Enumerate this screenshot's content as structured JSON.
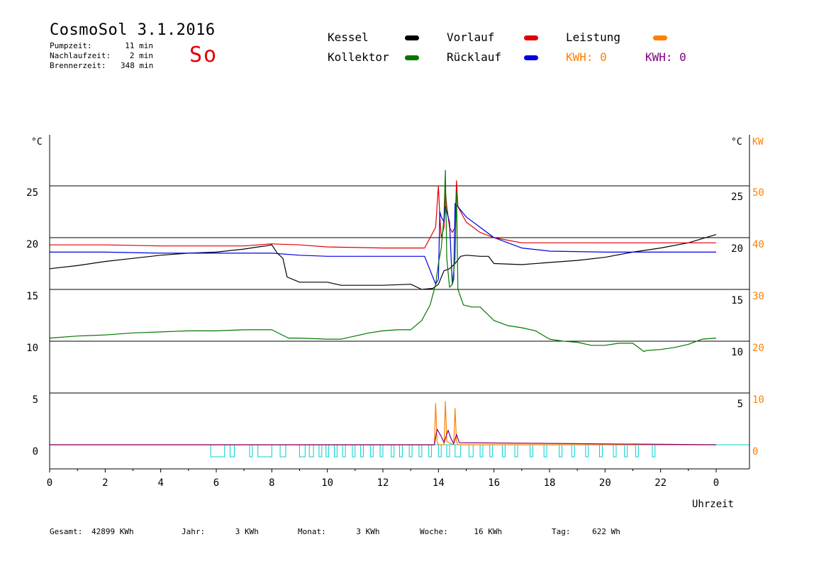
{
  "header": {
    "title": "CosmoSol 3.1.2016",
    "pump_label": "Pumpzeit:",
    "pump_value": "11 min",
    "after_label": "Nachlaufzeit:",
    "after_value": "2 min",
    "burner_label": "Brennerzeit:",
    "burner_value": "348 min",
    "weekday": "So"
  },
  "legend": {
    "kessel": "Kessel",
    "kollektor": "Kollektor",
    "vorlauf": "Vorlauf",
    "ruecklauf": "Rücklauf",
    "leistung": "Leistung",
    "kwh_orange": "KWH: 0",
    "kwh_purple": "KWH: 0",
    "colors": {
      "kessel": "#000000",
      "kollektor": "#007800",
      "vorlauf": "#e00000",
      "ruecklauf": "#0000e0",
      "leistung": "#ff8000",
      "purple": "#800080",
      "pump": "#00d0d0"
    }
  },
  "footer": {
    "gesamt_label": "Gesamt:",
    "gesamt_value": "42899 KWh",
    "jahr_label": "Jahr:",
    "jahr_value": "3 KWh",
    "monat_label": "Monat:",
    "monat_value": "3 KWh",
    "woche_label": "Woche:",
    "woche_value": "16 KWh",
    "tag_label": "Tag:",
    "tag_value": "622 Wh"
  },
  "chart_data": {
    "type": "line",
    "xlabel": "Uhrzeit",
    "left_unit": "°C",
    "right_unit_temp": "°C",
    "right_unit_power": "KW",
    "xlim": [
      0,
      24
    ],
    "ylim": [
      -2.3,
      30
    ],
    "x_ticks": [
      "0",
      "2",
      "4",
      "6",
      "8",
      "10",
      "12",
      "14",
      "16",
      "18",
      "20",
      "22",
      "0"
    ],
    "left_ticks": [
      0,
      5,
      10,
      15,
      20,
      25
    ],
    "right_temp_ticks": [
      5,
      10,
      15,
      20,
      25
    ],
    "right_power_ticks": [
      0,
      10,
      20,
      30,
      40,
      50
    ],
    "gridlines": [
      0,
      5,
      10,
      15,
      20,
      25
    ],
    "series": [
      {
        "name": "Kessel",
        "color": "#000000",
        "x": [
          0,
          1,
          2,
          3,
          4,
          5,
          6,
          7,
          7.5,
          7.8,
          8.0,
          8.2,
          8.4,
          8.55,
          9,
          10,
          10.5,
          11,
          12,
          13,
          13.4,
          13.8,
          14.0,
          14.2,
          14.4,
          14.6,
          14.8,
          15.0,
          15.5,
          15.8,
          16,
          17,
          18,
          19,
          20,
          21,
          22,
          23,
          24
        ],
        "y": [
          17.0,
          17.3,
          17.7,
          18.0,
          18.3,
          18.5,
          18.6,
          18.9,
          19.1,
          19.2,
          19.3,
          18.5,
          18.0,
          16.2,
          15.7,
          15.7,
          15.4,
          15.4,
          15.4,
          15.5,
          15.0,
          15.1,
          15.5,
          16.8,
          17.0,
          17.5,
          18.2,
          18.3,
          18.2,
          18.2,
          17.5,
          17.4,
          17.6,
          17.8,
          18.1,
          18.6,
          19.0,
          19.5,
          20.3
        ]
      },
      {
        "name": "Vorlauf",
        "color": "#e00000",
        "x": [
          0,
          2,
          4,
          6,
          7,
          8,
          9,
          10,
          12,
          13.5,
          13.9,
          14.0,
          14.05,
          14.1,
          14.2,
          14.25,
          14.3,
          14.4,
          14.5,
          14.6,
          14.65,
          14.7,
          15,
          15.5,
          16,
          17,
          18,
          20,
          22,
          24
        ],
        "y": [
          19.3,
          19.3,
          19.2,
          19.2,
          19.2,
          19.4,
          19.3,
          19.1,
          19.0,
          19.0,
          21.0,
          25.0,
          22.0,
          20.0,
          21.0,
          24.5,
          23.0,
          21.0,
          20.5,
          21.0,
          25.5,
          23.0,
          21.5,
          20.5,
          20.0,
          19.5,
          19.5,
          19.5,
          19.5,
          19.5
        ]
      },
      {
        "name": "Rücklauf",
        "color": "#0000e0",
        "x": [
          0,
          2,
          4,
          6,
          8,
          9,
          10,
          12,
          13.5,
          13.9,
          14.0,
          14.05,
          14.1,
          14.2,
          14.25,
          14.3,
          14.4,
          14.5,
          14.55,
          14.6,
          14.7,
          15,
          15.5,
          16,
          16.5,
          17,
          18,
          20,
          22,
          24
        ],
        "y": [
          18.6,
          18.6,
          18.5,
          18.5,
          18.5,
          18.3,
          18.2,
          18.2,
          18.2,
          15.5,
          16.0,
          22.5,
          22.0,
          21.5,
          23.0,
          22.5,
          21.5,
          15.5,
          16.0,
          23.3,
          23.0,
          22.0,
          21.0,
          20.0,
          19.5,
          19.0,
          18.7,
          18.6,
          18.6,
          18.6
        ]
      },
      {
        "name": "Kollektor",
        "color": "#007800",
        "x": [
          0,
          1,
          2,
          3,
          4,
          5,
          6,
          7,
          8,
          8.6,
          9,
          10,
          10.5,
          11,
          11.5,
          12,
          12.5,
          13,
          13.4,
          13.7,
          13.9,
          14.0,
          14.1,
          14.2,
          14.25,
          14.3,
          14.4,
          14.5,
          14.6,
          14.65,
          14.7,
          14.9,
          15.2,
          15.5,
          16,
          16.5,
          17,
          17.5,
          18,
          18.5,
          19,
          19.5,
          20,
          20.5,
          21,
          21.4,
          21.5,
          22,
          22.5,
          23,
          23.5,
          24
        ],
        "y": [
          10.3,
          10.5,
          10.6,
          10.8,
          10.9,
          11.0,
          11.0,
          11.1,
          11.1,
          10.3,
          10.3,
          10.2,
          10.2,
          10.5,
          10.8,
          11.0,
          11.1,
          11.1,
          12.0,
          13.5,
          15.5,
          17.5,
          19.0,
          22.0,
          26.5,
          18.0,
          15.2,
          15.5,
          18.0,
          24.5,
          15.0,
          13.5,
          13.3,
          13.3,
          12.0,
          11.5,
          11.3,
          11.0,
          10.2,
          10.0,
          9.9,
          9.6,
          9.6,
          9.8,
          9.8,
          9.0,
          9.1,
          9.2,
          9.4,
          9.7,
          10.2,
          10.3
        ]
      },
      {
        "name": "Leistung",
        "color": "#ff8000",
        "x": [
          0,
          13.85,
          13.9,
          13.95,
          14.0,
          14.2,
          14.25,
          14.3,
          14.55,
          14.6,
          14.65,
          14.7,
          14.75,
          24
        ],
        "y": [
          0,
          0,
          4.0,
          0.3,
          0,
          0,
          4.2,
          0.3,
          0,
          3.5,
          0.3,
          0,
          0,
          0
        ]
      },
      {
        "name": "Leistung2",
        "color": "#800080",
        "x": [
          0,
          13.85,
          13.95,
          14.1,
          14.2,
          14.35,
          14.45,
          14.55,
          14.65,
          14.75,
          24
        ],
        "y": [
          0,
          0,
          1.5,
          0.8,
          0.2,
          1.4,
          0.6,
          0.1,
          1.0,
          0.2,
          0
        ]
      }
    ],
    "pump_pulses": [
      [
        5.8,
        6.3
      ],
      [
        6.5,
        6.65
      ],
      [
        7.2,
        7.3
      ],
      [
        7.5,
        8.0
      ],
      [
        8.3,
        8.5
      ],
      [
        9.0,
        9.2
      ],
      [
        9.35,
        9.5
      ],
      [
        9.7,
        9.8
      ],
      [
        9.95,
        10.05
      ],
      [
        10.25,
        10.35
      ],
      [
        10.55,
        10.65
      ],
      [
        10.9,
        11.0
      ],
      [
        11.2,
        11.3
      ],
      [
        11.55,
        11.65
      ],
      [
        11.9,
        12.0
      ],
      [
        12.3,
        12.4
      ],
      [
        12.6,
        12.7
      ],
      [
        12.95,
        13.05
      ],
      [
        13.3,
        13.4
      ],
      [
        13.65,
        13.75
      ],
      [
        14.0,
        14.1
      ],
      [
        14.3,
        14.4
      ],
      [
        14.6,
        14.8
      ],
      [
        15.1,
        15.25
      ],
      [
        15.5,
        15.6
      ],
      [
        15.85,
        15.95
      ],
      [
        16.3,
        16.4
      ],
      [
        16.75,
        16.85
      ],
      [
        17.3,
        17.4
      ],
      [
        17.8,
        17.9
      ],
      [
        18.35,
        18.45
      ],
      [
        18.8,
        18.9
      ],
      [
        19.3,
        19.4
      ],
      [
        19.8,
        19.9
      ],
      [
        20.3,
        20.4
      ],
      [
        20.7,
        20.8
      ],
      [
        21.1,
        21.2
      ],
      [
        21.7,
        21.8
      ]
    ]
  }
}
